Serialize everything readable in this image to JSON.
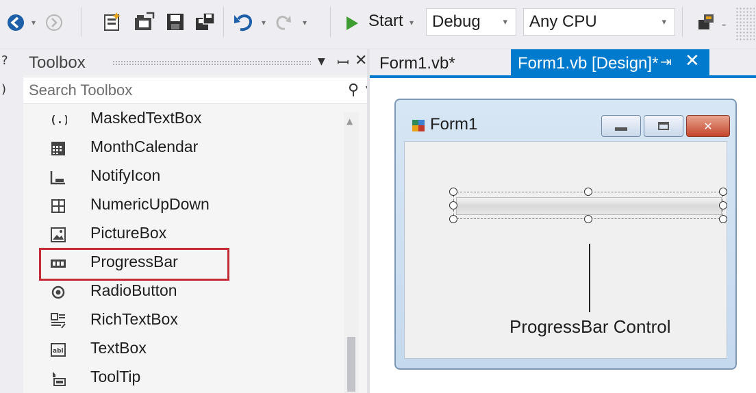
{
  "toolbar": {
    "start_label": "Start",
    "configuration": "Debug",
    "platform": "Any CPU"
  },
  "toolbox": {
    "title": "Toolbox",
    "search_placeholder": "Search Toolbox",
    "items": [
      {
        "label": "MaskedTextBox",
        "icon": "masked-textbox-icon"
      },
      {
        "label": "MonthCalendar",
        "icon": "month-calendar-icon"
      },
      {
        "label": "NotifyIcon",
        "icon": "notify-icon-icon"
      },
      {
        "label": "NumericUpDown",
        "icon": "numeric-updown-icon"
      },
      {
        "label": "PictureBox",
        "icon": "picturebox-icon"
      },
      {
        "label": "ProgressBar",
        "icon": "progressbar-icon"
      },
      {
        "label": "RadioButton",
        "icon": "radiobutton-icon"
      },
      {
        "label": "RichTextBox",
        "icon": "richtextbox-icon"
      },
      {
        "label": "TextBox",
        "icon": "textbox-icon"
      },
      {
        "label": "ToolTip",
        "icon": "tooltip-icon"
      }
    ],
    "highlighted_item": "ProgressBar"
  },
  "tabs": [
    {
      "label": "Form1.vb*",
      "active": false
    },
    {
      "label": "Form1.vb [Design]*",
      "active": true
    }
  ],
  "designer": {
    "form_title": "Form1",
    "callout_label": "ProgressBar Control"
  },
  "colors": {
    "accent": "#007acc",
    "highlight": "#c42b34",
    "start_green": "#3d9c32"
  }
}
